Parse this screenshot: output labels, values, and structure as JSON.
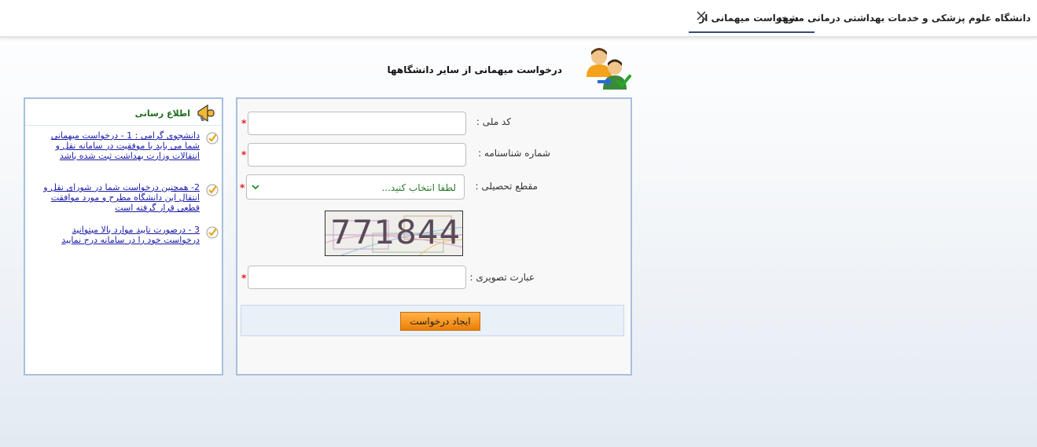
{
  "app": {
    "title": "دانشگاه علوم پزشکی و خدمات بهداشتی درمانی مشهد"
  },
  "tab": {
    "label": "درخواست میهمانی از",
    "close_symbol": "✕"
  },
  "page": {
    "title": "درخواست میهمانی از سایر دانشگاهها",
    "icon": "users-approve-icon"
  },
  "form": {
    "national_code": {
      "label": "کد ملی :",
      "value": "",
      "required_mark": "*"
    },
    "id_number": {
      "label": "شماره شناسنامه :",
      "value": "",
      "required_mark": "*"
    },
    "education_level": {
      "label": "مقطع تحصیلی :",
      "selected": "لطفا انتخاب کنید...",
      "required_mark": "*"
    },
    "captcha": {
      "text": "771844"
    },
    "captcha_input": {
      "label": "عبارت تصویری :",
      "value": "",
      "required_mark": "*"
    },
    "submit_label": "ایجاد درخواست"
  },
  "news": {
    "title": "اطلاع رسانی",
    "icon": "megaphone-icon",
    "items": [
      {
        "text": "دانشجوی گرامی : 1 - درخواست میهمانی شما می باید با موفقیت در سامانه نقل و انتقالات وزارت بهداشت ثبت شده باشد"
      },
      {
        "text": "2- همچنین درخواست شما در شورای نقل و انتقال این دانشگاه مطرح و مورد موافقت قطعی قرار گرفته است"
      },
      {
        "text": "3 - درصورت تایید موارد بالا میتوانید درخواست خود را در سامانه درج نمایید"
      }
    ]
  },
  "colors": {
    "accent_border": "#a9bfdc",
    "button": "#f7941d",
    "required": "#e02020",
    "news_title": "#1d6b1d",
    "link": "#1a1aa6"
  }
}
